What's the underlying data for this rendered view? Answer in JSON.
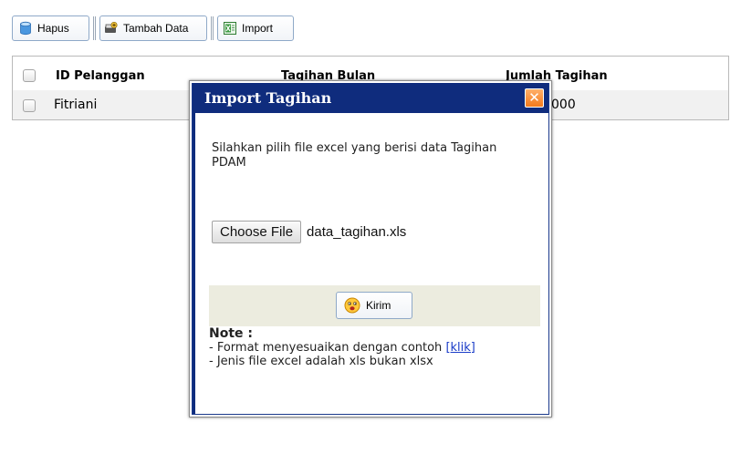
{
  "toolbar": {
    "hapus_label": "Hapus",
    "tambah_label": "Tambah Data",
    "import_label": "Import"
  },
  "grid": {
    "columns": [
      "ID Pelanggan",
      "Tagihan Bulan",
      "Jumlah Tagihan"
    ],
    "rows": [
      {
        "id_pelanggan": "Fitriani",
        "tagihan_bulan": "",
        "jumlah_tagihan": "000"
      }
    ]
  },
  "dialog": {
    "title": "Import Tagihan",
    "close_glyph": "✕",
    "instruction": "Silahkan pilih file excel yang berisi data Tagihan PDAM",
    "choose_label": "Choose File",
    "file_name": "data_tagihan.xls",
    "submit_label": "Kirim",
    "note_title": "Note :",
    "note_line1_prefix": "- Format menyesuaikan dengan contoh ",
    "note_line1_link": "[klik]",
    "note_line2": "- Jenis file excel adalah xls bukan xlsx"
  },
  "colors": {
    "dialog_header": "#0f2c7d",
    "close_button": "#f47a1c",
    "submit_bar": "#ececdf",
    "link": "#1a3cc8"
  },
  "icons": {
    "hapus": "database-icon",
    "tambah": "add-record-icon",
    "import": "excel-icon",
    "kirim": "smiley-icon",
    "close": "close-icon"
  }
}
